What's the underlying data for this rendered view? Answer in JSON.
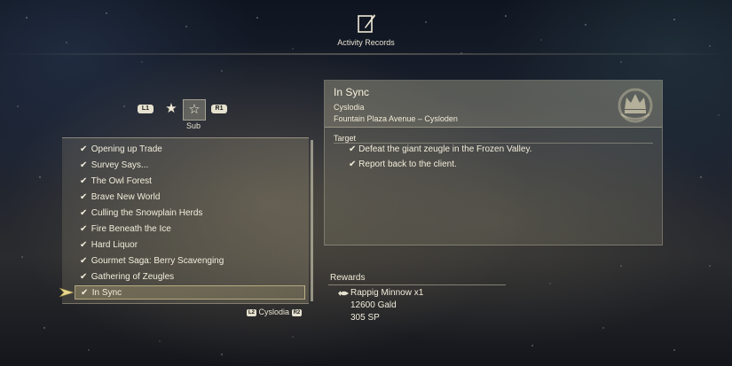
{
  "header": {
    "title": "Activity Records",
    "icon": "quill-notebook-icon"
  },
  "tabs": {
    "left_button": "L1",
    "right_button": "R1",
    "items": [
      {
        "icon": "star-filled-icon",
        "selected": false
      },
      {
        "icon": "star-outline-icon",
        "selected": true
      }
    ],
    "active_label": "Sub"
  },
  "quest_list": {
    "check": "✔",
    "items": [
      {
        "name": "Opening up Trade"
      },
      {
        "name": "Survey Says..."
      },
      {
        "name": "The Owl Forest"
      },
      {
        "name": "Brave New World"
      },
      {
        "name": "Culling the Snowplain Herds"
      },
      {
        "name": "Fire Beneath the Ice"
      },
      {
        "name": "Hard Liquor"
      },
      {
        "name": "Gourmet Saga: Berry Scavenging"
      },
      {
        "name": "Gathering of Zeugles"
      },
      {
        "name": "In Sync"
      }
    ],
    "selected_index": 9
  },
  "region_filter": {
    "left_button": "L2",
    "label": "Cyslodia",
    "right_button": "R2"
  },
  "detail": {
    "title": "In Sync",
    "region": "Cyslodia",
    "location": "Fountain Plaza Avenue – Cysloden",
    "target_label": "Target",
    "objectives": [
      {
        "text": "Defeat the giant zeugle in the Frozen Valley."
      },
      {
        "text": "Report back to the client."
      }
    ],
    "emblem": "crown-emblem-icon"
  },
  "rewards": {
    "label": "Rewards",
    "items": [
      {
        "text": "Rappig Minnow x1",
        "icon": "fish-icon"
      },
      {
        "text": "12600 Gald"
      },
      {
        "text": "305 SP"
      }
    ]
  },
  "colors": {
    "text": "#f1ecd9",
    "accent_gold": "#d9c98a",
    "button_bg": "#e6e1cf"
  }
}
